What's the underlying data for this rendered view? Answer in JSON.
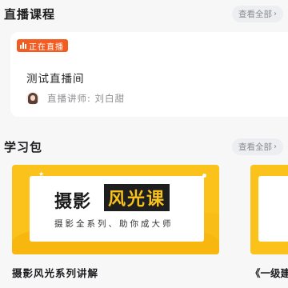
{
  "live_section": {
    "title": "直播课程",
    "see_all": "查看全部",
    "card": {
      "status_tag": "正在直播",
      "course_title": "测试直播间",
      "teacher_label": "直播讲师: 刘白甜"
    }
  },
  "package_section": {
    "title": "学习包",
    "see_all": "查看全部",
    "items": [
      {
        "banner_main": "摄影",
        "banner_highlight": "风光课",
        "banner_sub": "摄影全系列、助你成大师",
        "name": "摄影风光系列讲解"
      },
      {
        "name": "《一级建"
      }
    ]
  },
  "colors": {
    "accent_orange": "#f25c20",
    "banner_yellow": "#fbc21c"
  }
}
